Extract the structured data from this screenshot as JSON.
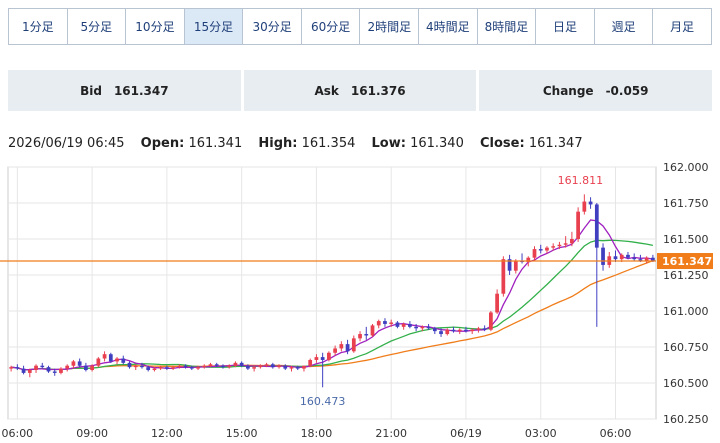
{
  "tabs": [
    {
      "label": "1分足"
    },
    {
      "label": "5分足"
    },
    {
      "label": "10分足"
    },
    {
      "label": "15分足",
      "active": true
    },
    {
      "label": "30分足"
    },
    {
      "label": "60分足"
    },
    {
      "label": "2時間足"
    },
    {
      "label": "4時間足"
    },
    {
      "label": "8時間足"
    },
    {
      "label": "日足"
    },
    {
      "label": "週足"
    },
    {
      "label": "月足"
    }
  ],
  "quotes": {
    "bid_label": "Bid",
    "bid_value": "161.347",
    "ask_label": "Ask",
    "ask_value": "161.376",
    "change_label": "Change",
    "change_value": "-0.059"
  },
  "ohlc": {
    "timestamp": "2026/06/19 06:45",
    "open_label": "Open:",
    "open": "161.341",
    "high_label": "High:",
    "high": "161.354",
    "low_label": "Low:",
    "low": "161.340",
    "close_label": "Close:",
    "close": "161.347"
  },
  "chart_data": {
    "type": "candlestick",
    "ylim": [
      160.25,
      162.0
    ],
    "yticks": [
      "162.000",
      "161.750",
      "161.500",
      "161.250",
      "161.000",
      "160.750",
      "160.500",
      "160.250"
    ],
    "xticks": [
      "06:00",
      "09:00",
      "12:00",
      "15:00",
      "18:00",
      "21:00",
      "06/19",
      "03:00",
      "06:00"
    ],
    "grid": true,
    "current_price": 161.347,
    "current_price_label": "161.347",
    "high_annotation": {
      "label": "161.811",
      "value": 161.811
    },
    "low_annotation": {
      "label": "160.473",
      "value": 160.473
    },
    "colors": {
      "up": "#e8404f",
      "down": "#3f3fc0",
      "ma_fast": "#a020c0",
      "ma_mid": "#33b04a",
      "ma_slow": "#f07d1a",
      "price_line": "#f07d1a",
      "grid": "#e6e6e6"
    },
    "candles": [
      [
        160.6,
        160.62,
        160.58,
        160.61
      ],
      [
        160.61,
        160.63,
        160.59,
        160.6
      ],
      [
        160.6,
        160.62,
        160.56,
        160.57
      ],
      [
        160.57,
        160.6,
        160.54,
        160.59
      ],
      [
        160.59,
        160.63,
        160.57,
        160.62
      ],
      [
        160.62,
        160.64,
        160.6,
        160.61
      ],
      [
        160.61,
        160.62,
        160.57,
        160.58
      ],
      [
        160.58,
        160.6,
        160.55,
        160.57
      ],
      [
        160.57,
        160.61,
        160.56,
        160.6
      ],
      [
        160.6,
        160.63,
        160.58,
        160.62
      ],
      [
        160.62,
        160.66,
        160.6,
        160.65
      ],
      [
        160.65,
        160.67,
        160.61,
        160.62
      ],
      [
        160.62,
        160.64,
        160.58,
        160.59
      ],
      [
        160.59,
        160.63,
        160.58,
        160.62
      ],
      [
        160.62,
        160.68,
        160.61,
        160.67
      ],
      [
        160.67,
        160.72,
        160.65,
        160.7
      ],
      [
        160.7,
        160.71,
        160.64,
        160.65
      ],
      [
        160.65,
        160.68,
        160.63,
        160.67
      ],
      [
        160.67,
        160.69,
        160.63,
        160.64
      ],
      [
        160.64,
        160.65,
        160.6,
        160.61
      ],
      [
        160.61,
        160.63,
        160.59,
        160.62
      ],
      [
        160.62,
        160.64,
        160.6,
        160.61
      ],
      [
        160.61,
        160.62,
        160.58,
        160.59
      ],
      [
        160.59,
        160.61,
        160.58,
        160.6
      ],
      [
        160.6,
        160.62,
        160.59,
        160.61
      ],
      [
        160.61,
        160.62,
        160.59,
        160.6
      ],
      [
        160.6,
        160.62,
        160.59,
        160.61
      ],
      [
        160.61,
        160.63,
        160.6,
        160.62
      ],
      [
        160.62,
        160.63,
        160.6,
        160.61
      ],
      [
        160.61,
        160.62,
        160.59,
        160.6
      ],
      [
        160.6,
        160.62,
        160.59,
        160.61
      ],
      [
        160.61,
        160.63,
        160.6,
        160.62
      ],
      [
        160.62,
        160.64,
        160.61,
        160.63
      ],
      [
        160.63,
        160.64,
        160.61,
        160.62
      ],
      [
        160.62,
        160.63,
        160.6,
        160.61
      ],
      [
        160.61,
        160.63,
        160.6,
        160.62
      ],
      [
        160.62,
        160.65,
        160.61,
        160.64
      ],
      [
        160.64,
        160.65,
        160.61,
        160.62
      ],
      [
        160.62,
        160.63,
        160.59,
        160.6
      ],
      [
        160.6,
        160.62,
        160.58,
        160.61
      ],
      [
        160.61,
        160.63,
        160.6,
        160.62
      ],
      [
        160.62,
        160.64,
        160.61,
        160.63
      ],
      [
        160.63,
        160.64,
        160.6,
        160.61
      ],
      [
        160.61,
        160.63,
        160.6,
        160.62
      ],
      [
        160.62,
        160.63,
        160.59,
        160.6
      ],
      [
        160.6,
        160.62,
        160.58,
        160.61
      ],
      [
        160.61,
        160.62,
        160.59,
        160.6
      ],
      [
        160.6,
        160.62,
        160.58,
        160.62
      ],
      [
        160.62,
        160.67,
        160.61,
        160.66
      ],
      [
        160.66,
        160.7,
        160.64,
        160.68
      ],
      [
        160.68,
        160.71,
        160.47,
        160.66
      ],
      [
        160.66,
        160.72,
        160.65,
        160.71
      ],
      [
        160.71,
        160.76,
        160.69,
        160.74
      ],
      [
        160.74,
        160.79,
        160.72,
        160.77
      ],
      [
        160.77,
        160.8,
        160.7,
        160.72
      ],
      [
        160.72,
        160.83,
        160.71,
        160.81
      ],
      [
        160.81,
        160.86,
        160.79,
        160.84
      ],
      [
        160.84,
        160.89,
        160.8,
        160.83
      ],
      [
        160.83,
        160.91,
        160.82,
        160.9
      ],
      [
        160.9,
        160.94,
        160.88,
        160.93
      ],
      [
        160.93,
        160.95,
        160.89,
        160.91
      ],
      [
        160.91,
        160.94,
        160.89,
        160.92
      ],
      [
        160.92,
        160.93,
        160.88,
        160.89
      ],
      [
        160.89,
        160.92,
        160.87,
        160.91
      ],
      [
        160.91,
        160.93,
        160.88,
        160.89
      ],
      [
        160.89,
        160.91,
        160.86,
        160.88
      ],
      [
        160.88,
        160.9,
        160.86,
        160.89
      ],
      [
        160.89,
        160.91,
        160.87,
        160.88
      ],
      [
        160.88,
        160.89,
        160.84,
        160.86
      ],
      [
        160.86,
        160.88,
        160.82,
        160.84
      ],
      [
        160.84,
        160.88,
        160.83,
        160.87
      ],
      [
        160.87,
        160.89,
        160.85,
        160.86
      ],
      [
        160.86,
        160.88,
        160.84,
        160.87
      ],
      [
        160.87,
        160.89,
        160.85,
        160.86
      ],
      [
        160.86,
        160.88,
        160.84,
        160.87
      ],
      [
        160.87,
        160.89,
        160.85,
        160.88
      ],
      [
        160.88,
        160.9,
        160.86,
        160.87
      ],
      [
        160.87,
        161.0,
        160.86,
        160.99
      ],
      [
        160.99,
        161.15,
        160.98,
        161.12
      ],
      [
        161.12,
        161.38,
        161.1,
        161.36
      ],
      [
        161.36,
        161.39,
        161.25,
        161.28
      ],
      [
        161.28,
        161.36,
        161.26,
        161.35
      ],
      [
        161.35,
        161.4,
        161.33,
        161.34
      ],
      [
        161.34,
        161.38,
        161.31,
        161.37
      ],
      [
        161.37,
        161.45,
        161.35,
        161.43
      ],
      [
        161.43,
        161.46,
        161.4,
        161.42
      ],
      [
        161.42,
        161.45,
        161.4,
        161.44
      ],
      [
        161.44,
        161.47,
        161.42,
        161.45
      ],
      [
        161.45,
        161.48,
        161.43,
        161.46
      ],
      [
        161.46,
        161.52,
        161.44,
        161.47
      ],
      [
        161.47,
        161.55,
        161.45,
        161.5
      ],
      [
        161.5,
        161.72,
        161.48,
        161.69
      ],
      [
        161.69,
        161.81,
        161.67,
        161.76
      ],
      [
        161.76,
        161.79,
        161.71,
        161.74
      ],
      [
        161.74,
        161.75,
        160.89,
        161.44
      ],
      [
        161.44,
        161.47,
        161.28,
        161.32
      ],
      [
        161.32,
        161.41,
        161.3,
        161.38
      ],
      [
        161.38,
        161.42,
        161.34,
        161.36
      ],
      [
        161.36,
        161.4,
        161.34,
        161.39
      ],
      [
        161.39,
        161.41,
        161.36,
        161.37
      ],
      [
        161.37,
        161.4,
        161.35,
        161.36
      ],
      [
        161.36,
        161.39,
        161.34,
        161.35
      ],
      [
        161.35,
        161.38,
        161.33,
        161.37
      ],
      [
        161.37,
        161.39,
        161.34,
        161.35
      ]
    ]
  }
}
